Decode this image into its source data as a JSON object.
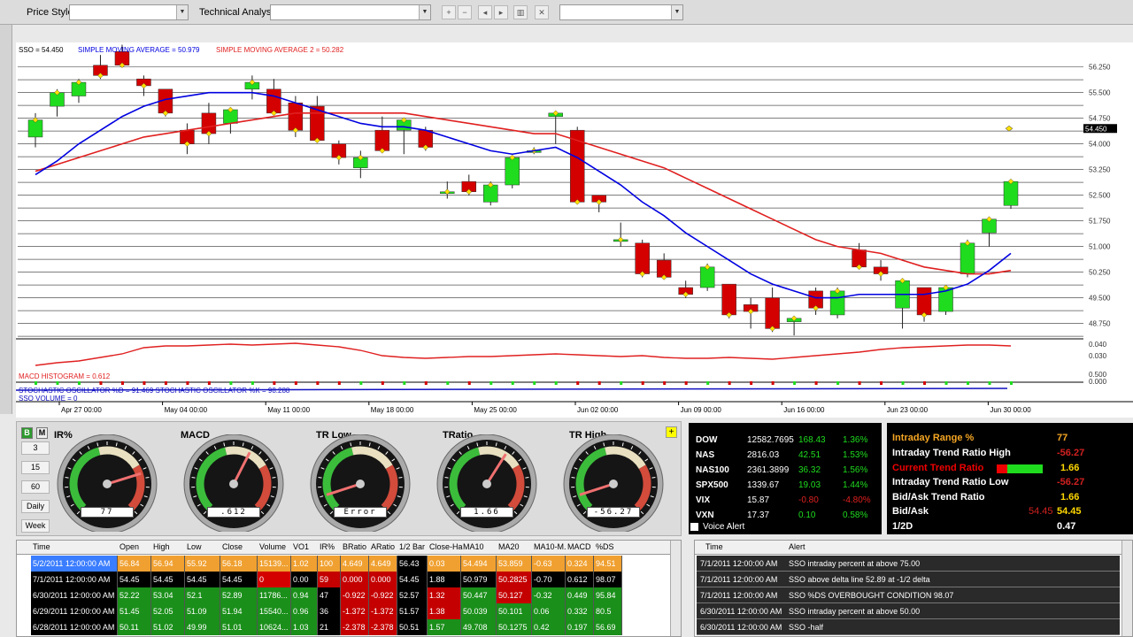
{
  "toolbar": {
    "price_style": "Price Style",
    "technical_analysis": "Technical Analysis"
  },
  "chart": {
    "symbol_label": "SSO = 54.450",
    "sma1_label": "SIMPLE MOVING AVERAGE = 50.979",
    "sma2_label": "SIMPLE MOVING AVERAGE 2 = 50.282",
    "last_price": "54.450",
    "macd_label": "MACD HISTOGRAM = 0.612",
    "stoch_label": "STOCHASTIC OSCILLATOR %D = 91.469   STOCHASTIC OSCILLATOR %K = 98.288",
    "volume_label": "SSO VOLUME = 0",
    "price_ticks": [
      "56.250",
      "55.500",
      "54.750",
      "54.000",
      "53.250",
      "52.500",
      "51.750",
      "51.000",
      "50.250",
      "49.500",
      "48.750"
    ],
    "macd_ticks": [
      "0.040",
      "0.030"
    ],
    "vol_ticks": [
      "0.500",
      "0.000"
    ],
    "date_ticks": [
      "Apr 27 00:00",
      "May 04 00:00",
      "May 11 00:00",
      "May 18 00:00",
      "May 25 00:00",
      "Jun 02 00:00",
      "Jun 09 00:00",
      "Jun 16 00:00",
      "Jun 23 00:00",
      "Jun 30 00:00"
    ],
    "colors": {
      "up": "#1fdc1f",
      "down": "#d40000",
      "sma1": "#0000e0",
      "sma2": "#e02020"
    }
  },
  "chart_data": {
    "type": "candlestick",
    "ylim": [
      48.3,
      56.5
    ],
    "candles": [
      [
        54.2,
        54.9,
        53.9,
        54.7
      ],
      [
        55.1,
        55.6,
        54.8,
        55.5
      ],
      [
        55.4,
        55.9,
        55.2,
        55.8
      ],
      [
        56.3,
        56.6,
        55.9,
        56.0
      ],
      [
        56.7,
        56.9,
        56.3,
        56.3
      ],
      [
        55.9,
        56.0,
        55.4,
        55.7
      ],
      [
        55.6,
        55.6,
        54.8,
        54.9
      ],
      [
        54.4,
        54.6,
        53.7,
        54.0
      ],
      [
        54.9,
        55.2,
        54.0,
        54.3
      ],
      [
        54.6,
        55.0,
        54.3,
        55.0
      ],
      [
        55.6,
        56.0,
        55.3,
        55.8
      ],
      [
        55.6,
        55.9,
        54.9,
        54.9
      ],
      [
        55.2,
        55.4,
        54.2,
        54.4
      ],
      [
        55.1,
        55.4,
        54.2,
        54.1
      ],
      [
        54.0,
        54.1,
        53.4,
        53.6
      ],
      [
        53.3,
        53.8,
        53.0,
        53.6
      ],
      [
        54.4,
        54.8,
        53.8,
        53.8
      ],
      [
        54.4,
        54.6,
        53.7,
        54.7
      ],
      [
        54.4,
        54.5,
        53.8,
        53.9
      ],
      [
        52.6,
        52.9,
        52.4,
        52.6
      ],
      [
        52.9,
        53.1,
        52.5,
        52.6
      ],
      [
        52.3,
        52.9,
        52.2,
        52.8
      ],
      [
        52.8,
        53.6,
        52.7,
        53.6
      ],
      [
        53.8,
        53.9,
        53.7,
        53.8
      ],
      [
        54.8,
        54.9,
        54.0,
        54.9
      ],
      [
        54.4,
        54.5,
        52.3,
        52.3
      ],
      [
        52.5,
        52.5,
        52.0,
        52.3
      ],
      [
        51.2,
        51.7,
        51.0,
        51.2
      ],
      [
        51.1,
        51.2,
        50.1,
        50.2
      ],
      [
        50.6,
        50.8,
        50.1,
        50.1
      ],
      [
        49.8,
        50.0,
        49.5,
        49.6
      ],
      [
        49.8,
        50.5,
        49.7,
        50.4
      ],
      [
        49.9,
        49.9,
        48.9,
        49.0
      ],
      [
        49.3,
        49.5,
        48.6,
        49.1
      ],
      [
        49.5,
        49.8,
        48.5,
        48.6
      ],
      [
        48.8,
        48.9,
        48.4,
        48.9
      ],
      [
        49.7,
        49.8,
        49.0,
        49.2
      ],
      [
        49.0,
        49.8,
        48.9,
        49.7
      ],
      [
        50.9,
        51.1,
        50.5,
        50.4
      ],
      [
        50.4,
        50.6,
        50.0,
        50.2
      ],
      [
        49.2,
        50.0,
        48.6,
        50.0
      ],
      [
        49.8,
        49.8,
        48.8,
        49.0
      ],
      [
        49.1,
        49.8,
        49.0,
        49.8
      ],
      [
        50.2,
        51.2,
        50.1,
        51.1
      ],
      [
        51.4,
        51.8,
        51.0,
        51.8
      ],
      [
        52.2,
        52.8,
        52.1,
        52.9
      ]
    ],
    "sma1": [
      53.1,
      53.5,
      54.0,
      54.4,
      54.8,
      55.1,
      55.3,
      55.4,
      55.5,
      55.5,
      55.5,
      55.4,
      55.2,
      55.0,
      54.8,
      54.6,
      54.5,
      54.5,
      54.4,
      54.2,
      54.0,
      53.8,
      53.7,
      53.8,
      53.9,
      53.6,
      53.2,
      52.8,
      52.3,
      51.9,
      51.4,
      51.0,
      50.6,
      50.2,
      49.9,
      49.7,
      49.5,
      49.5,
      49.6,
      49.6,
      49.6,
      49.6,
      49.7,
      49.9,
      50.3,
      50.8
    ],
    "sma2": [
      53.2,
      53.4,
      53.6,
      53.8,
      54.0,
      54.2,
      54.3,
      54.4,
      54.5,
      54.6,
      54.7,
      54.8,
      54.9,
      54.9,
      54.9,
      54.9,
      54.9,
      54.9,
      54.8,
      54.7,
      54.6,
      54.5,
      54.4,
      54.3,
      54.3,
      54.1,
      53.9,
      53.7,
      53.5,
      53.3,
      53.0,
      52.7,
      52.4,
      52.1,
      51.8,
      51.5,
      51.2,
      51.0,
      50.9,
      50.8,
      50.6,
      50.4,
      50.3,
      50.2,
      50.2,
      50.3
    ],
    "last": 54.45
  },
  "panel": {
    "buttons": [
      "3",
      "15",
      "60",
      "Daily",
      "Week"
    ],
    "gauges": [
      {
        "label": "IR%",
        "display": "77",
        "value": 0.77
      },
      {
        "label": "MACD",
        "display": ".612",
        "value": 0.6
      },
      {
        "label": "TR Low",
        "display": "Error",
        "value": 0.1
      },
      {
        "label": "TRatio",
        "display": "1.66",
        "value": 0.62
      },
      {
        "label": "TR High",
        "display": "-56.27",
        "value": 0.1
      }
    ]
  },
  "indices": [
    {
      "name": "DOW",
      "price": "12582.7695",
      "chg": "168.43",
      "pct": "1.36%",
      "pos": true
    },
    {
      "name": "NAS",
      "price": "2816.03",
      "chg": "42.51",
      "pct": "1.53%",
      "pos": true
    },
    {
      "name": "NAS100",
      "price": "2361.3899",
      "chg": "36.32",
      "pct": "1.56%",
      "pos": true
    },
    {
      "name": "SPX500",
      "price": "1339.67",
      "chg": "19.03",
      "pct": "1.44%",
      "pos": true
    },
    {
      "name": "VIX",
      "price": "15.87",
      "chg": "-0.80",
      "pct": "-4.80%",
      "pos": false
    },
    {
      "name": "VXN",
      "price": "17.37",
      "chg": "0.10",
      "pct": "0.58%",
      "pos": true
    }
  ],
  "voice_alert": "Voice Alert",
  "trend": {
    "range_label": "Intraday Range %",
    "range_value": "77",
    "high_label": "Intraday Trend Ratio High",
    "high_value": "-56.27",
    "current_label": "Current Trend Ratio",
    "current_value": "1.66",
    "low_label": "Intraday Trend Ratio Low",
    "low_value": "-56.27",
    "bidask_trend_label": "Bid/Ask Trend Ratio",
    "bidask_trend_value": "1.66",
    "bidask_label": "Bid/Ask",
    "bid": "54.45",
    "ask": "54.45",
    "half_label": "1/2D",
    "half_value": "0.47"
  },
  "table": {
    "headers": [
      "Time",
      "Open",
      "High",
      "Low",
      "Close",
      "Volume",
      "VO1",
      "IR%",
      "BRatio",
      "ARatio",
      "1/2 Bar",
      "Close-Ha",
      "MA10",
      "MA20",
      "MA10-M.",
      "MACD",
      "%DS"
    ],
    "rows": [
      [
        "5/2/2011 12:00:00 AM",
        "56.84",
        "56.94",
        "55.92",
        "56.18",
        "15139...",
        "1.02",
        "100",
        "4.649",
        "4.649",
        "56.43",
        "0.03",
        "54.494",
        "53.859",
        "-0.63",
        "0.324",
        "94.51"
      ],
      [
        "7/1/2011 12:00:00 AM",
        "54.45",
        "54.45",
        "54.45",
        "54.45",
        "0",
        "0.00",
        "59",
        "0.000",
        "0.000",
        "54.45",
        "1.88",
        "50.979",
        "50.2825",
        "-0.70",
        "0.612",
        "98.07"
      ],
      [
        "6/30/2011 12:00:00 AM",
        "52.22",
        "53.04",
        "52.1",
        "52.89",
        "11786...",
        "0.94",
        "47",
        "-0.922",
        "-0.922",
        "52.57",
        "1.32",
        "50.447",
        "50.127",
        "-0.32",
        "0.449",
        "95.84"
      ],
      [
        "6/29/2011 12:00:00 AM",
        "51.45",
        "52.05",
        "51.09",
        "51.94",
        "15540...",
        "0.96",
        "36",
        "-1.372",
        "-1.372",
        "51.57",
        "1.38",
        "50.039",
        "50.101",
        "0.06",
        "0.332",
        "80.5"
      ],
      [
        "6/28/2011 12:00:00 AM",
        "50.11",
        "51.02",
        "49.99",
        "51.01",
        "10624...",
        "1.03",
        "21",
        "-2.378",
        "-2.378",
        "50.51",
        "1.57",
        "49.708",
        "50.1275",
        "0.42",
        "0.197",
        "56.69"
      ]
    ]
  },
  "alerts": {
    "headers": [
      "Time",
      "Alert"
    ],
    "rows": [
      [
        "7/1/2011 12:00:00 AM",
        "SSO intraday percent at above 75.00"
      ],
      [
        "7/1/2011 12:00:00 AM",
        "SSO above delta line 52.89 at -1/2 delta"
      ],
      [
        "7/1/2011 12:00:00 AM",
        "SSO %DS OVERBOUGHT CONDITION 98.07"
      ],
      [
        "6/30/2011 12:00:00 AM",
        "SSO intraday percent at above 50.00"
      ],
      [
        "6/30/2011 12:00:00 AM",
        "SSO -half"
      ]
    ]
  }
}
